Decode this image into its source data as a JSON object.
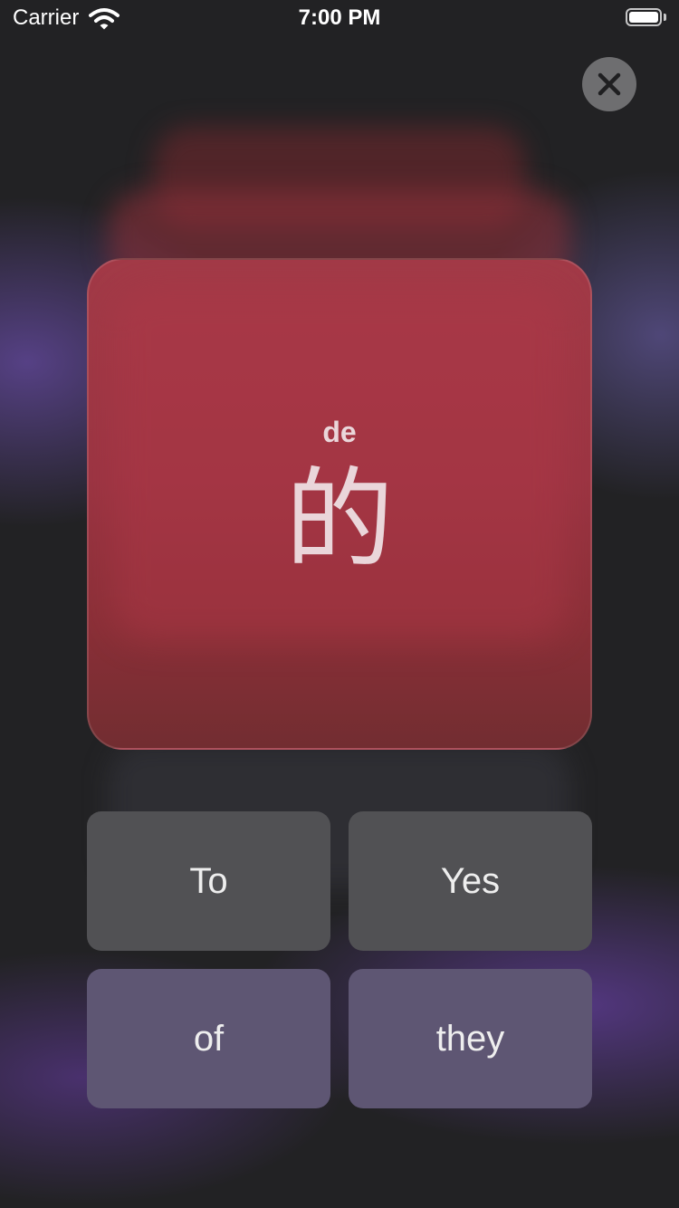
{
  "status_bar": {
    "carrier": "Carrier",
    "time": "7:00 PM",
    "wifi_icon": "wifi-icon",
    "battery_icon": "battery-full-icon"
  },
  "close_button": {
    "icon": "close-icon",
    "color": "#6e6e70"
  },
  "flashcard": {
    "pinyin": "de",
    "character": "的",
    "color": "#9b3442"
  },
  "answers": [
    {
      "label": "To"
    },
    {
      "label": "Yes"
    },
    {
      "label": "of"
    },
    {
      "label": "they"
    }
  ]
}
